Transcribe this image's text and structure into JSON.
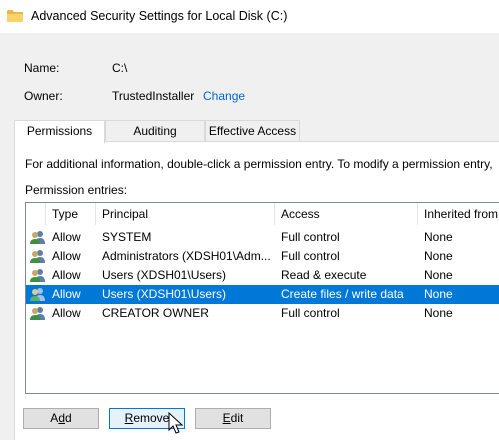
{
  "window": {
    "title": "Advanced Security Settings for Local Disk (C:)",
    "icon": "folder-icon"
  },
  "details": {
    "name_label": "Name:",
    "name_value": "C:\\",
    "owner_label": "Owner:",
    "owner_value": "TrustedInstaller",
    "change_link": "Change"
  },
  "tabs": [
    {
      "label": "Permissions",
      "active": true
    },
    {
      "label": "Auditing",
      "active": false
    },
    {
      "label": "Effective Access",
      "active": false
    }
  ],
  "permissions": {
    "info_text": "For additional information, double-click a permission entry. To modify a permission entry,",
    "entries_label": "Permission entries:",
    "columns": [
      "Type",
      "Principal",
      "Access",
      "Inherited from"
    ],
    "rows": [
      {
        "type": "Allow",
        "principal": "SYSTEM",
        "access": "Full control",
        "inherited": "None",
        "selected": false
      },
      {
        "type": "Allow",
        "principal": "Administrators (XDSH01\\Adm...",
        "access": "Full control",
        "inherited": "None",
        "selected": false
      },
      {
        "type": "Allow",
        "principal": "Users (XDSH01\\Users)",
        "access": "Read & execute",
        "inherited": "None",
        "selected": false
      },
      {
        "type": "Allow",
        "principal": "Users (XDSH01\\Users)",
        "access": "Create files / write data",
        "inherited": "None",
        "selected": true
      },
      {
        "type": "Allow",
        "principal": "CREATOR OWNER",
        "access": "Full control",
        "inherited": "None",
        "selected": false
      }
    ]
  },
  "buttons": {
    "add": {
      "pre": "A",
      "ul": "d",
      "post": "d"
    },
    "remove": {
      "pre": "",
      "ul": "R",
      "post": "emove"
    },
    "edit": {
      "pre": "",
      "ul": "E",
      "post": "dit"
    }
  },
  "colors": {
    "selection": "#0078d7",
    "link": "#0066cc"
  }
}
